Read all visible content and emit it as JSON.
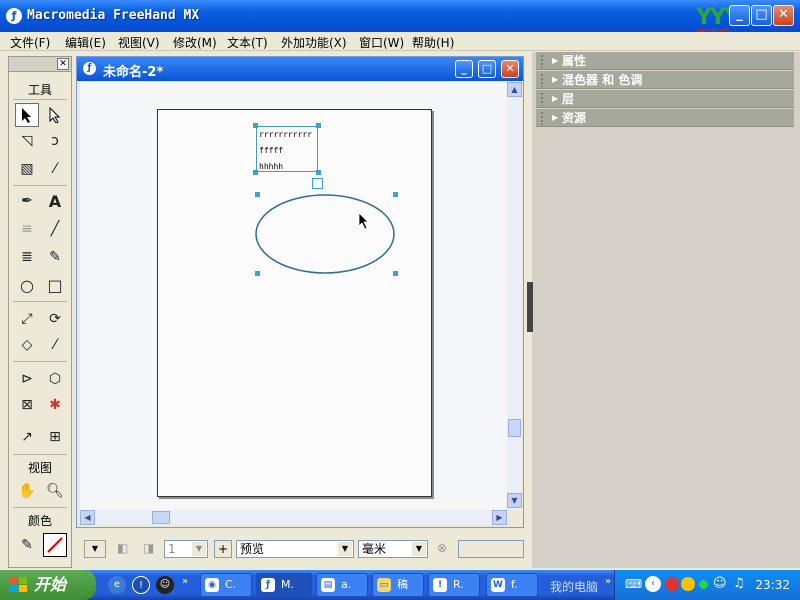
{
  "window": {
    "title": "Macromedia FreeHand MX",
    "app_icon": "freehand-icon",
    "controls": {
      "minimize": "_",
      "maximize": "□",
      "close": "✕"
    }
  },
  "logo": {
    "mark": "YYY",
    "text": "育硕苑",
    "colors": {
      "mark": "#2fa63a",
      "text": "#c8281d"
    }
  },
  "menu": [
    "文件(F)",
    "编辑(E)",
    "视图(V)",
    "修改(M)",
    "文本(T)",
    "外加功能(X)",
    "窗口(W)",
    "帮助(H)"
  ],
  "toolpanel": {
    "title": "工具",
    "view_label": "视图",
    "color_label": "颜色",
    "tools": [
      "pointer-tool",
      "subselect-tool",
      "lasso-tool",
      "freeform-tool",
      "trace-tool",
      "eyedropper-tool",
      "pen-tool",
      "text-tool",
      "line-tool",
      "bezigon-tool",
      "pencil-tool",
      "ellipse-tool",
      "rectangle-tool",
      "scale-tool",
      "rotate-tool",
      "eraser-tool",
      "knife-tool",
      "extrude-tool",
      "perspective-tool",
      "fill-tool",
      "mesh-tool",
      "hand-tool",
      "zoom-tool"
    ]
  },
  "document": {
    "title": "未命名-2*",
    "text_lines": [
      "rrrrrrrrrrr",
      "fffff",
      "hhhhh"
    ]
  },
  "statusbar": {
    "page": "1",
    "view_mode": "预览",
    "units": "毫米"
  },
  "dock": {
    "items": [
      "属性",
      "混色器 和 色调",
      "层",
      "资源"
    ],
    "color_header": "#A5A89A"
  },
  "taskbar": {
    "start": "开始",
    "buttons": [
      "C.",
      "M.",
      "a.",
      "稿",
      "R.",
      "f."
    ],
    "my_computer": "我的电脑",
    "clock": "23:32",
    "colors": {
      "bar": "#245edb",
      "start": "#3c8e34"
    }
  }
}
